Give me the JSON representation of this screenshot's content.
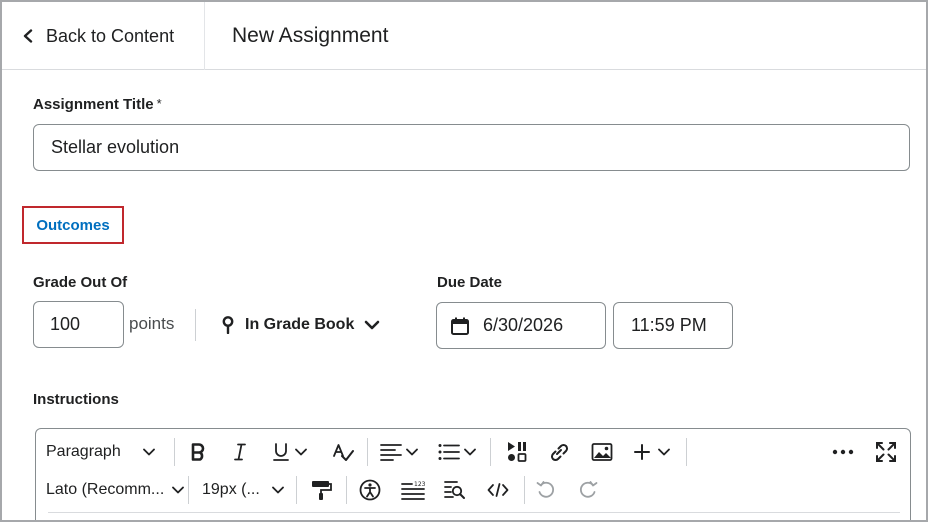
{
  "header": {
    "back_label": "Back to Content",
    "title": "New Assignment"
  },
  "assignment_title": {
    "label": "Assignment Title",
    "required_marker": "*",
    "value": "Stellar evolution"
  },
  "outcomes": {
    "label": "Outcomes"
  },
  "grade": {
    "label": "Grade Out Of",
    "value": "100",
    "unit": "points",
    "gradebook_label": "In Grade Book"
  },
  "due_date": {
    "label": "Due Date",
    "date": "6/30/2026",
    "time": "11:59 PM"
  },
  "instructions": {
    "label": "Instructions",
    "toolbar": {
      "block_format": "Paragraph",
      "font_family": "Lato (Recomm...",
      "font_size": "19px (..."
    }
  },
  "colors": {
    "link_blue": "#006fbf",
    "highlight_red": "#c0282d",
    "border_gray": "#868c8f",
    "text_dark": "#202122"
  }
}
